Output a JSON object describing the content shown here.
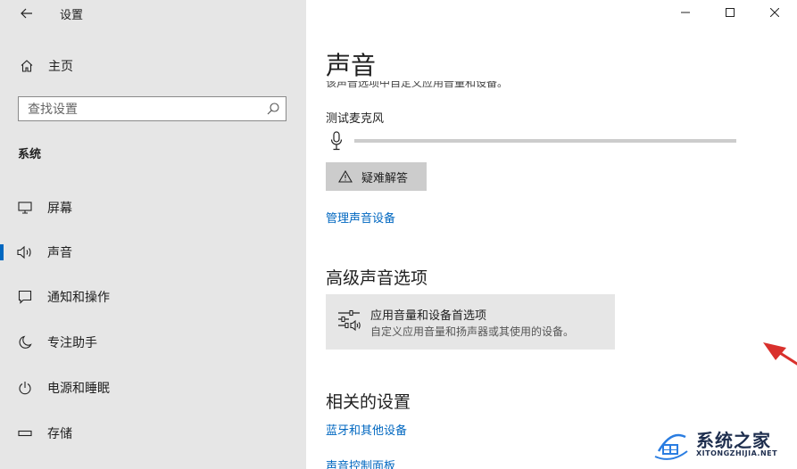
{
  "titlebar": {
    "title": "设置"
  },
  "sidebar": {
    "home_label": "主页",
    "search_placeholder": "查找设置",
    "section_label": "系统",
    "items": [
      {
        "label": "屏幕",
        "icon": "monitor-icon"
      },
      {
        "label": "声音",
        "icon": "speaker-icon",
        "active": true
      },
      {
        "label": "通知和操作",
        "icon": "notification-icon"
      },
      {
        "label": "专注助手",
        "icon": "moon-icon"
      },
      {
        "label": "电源和睡眠",
        "icon": "power-icon"
      },
      {
        "label": "存储",
        "icon": "storage-icon"
      }
    ]
  },
  "main": {
    "title": "声音",
    "cut_text": "该声音选项中自定义应用音量和设备。",
    "mic_test_label": "测试麦克风",
    "mic_level": 0,
    "troubleshoot_label": "疑难解答",
    "manage_devices_link": "管理声音设备",
    "advanced_heading": "高级声音选项",
    "advanced_item": {
      "title": "应用音量和设备首选项",
      "subtitle": "自定义应用音量和扬声器或其使用的设备。"
    },
    "related_heading": "相关的设置",
    "bluetooth_link": "蓝牙和其他设备",
    "control_panel_link": "声音控制面板"
  },
  "watermark": {
    "title": "系统之家",
    "subtitle": "XITONGZHIJIA.NET"
  },
  "colors": {
    "accent": "#0067c0",
    "sidebar_bg": "#e6e6e6",
    "arrow": "#d9302c"
  }
}
